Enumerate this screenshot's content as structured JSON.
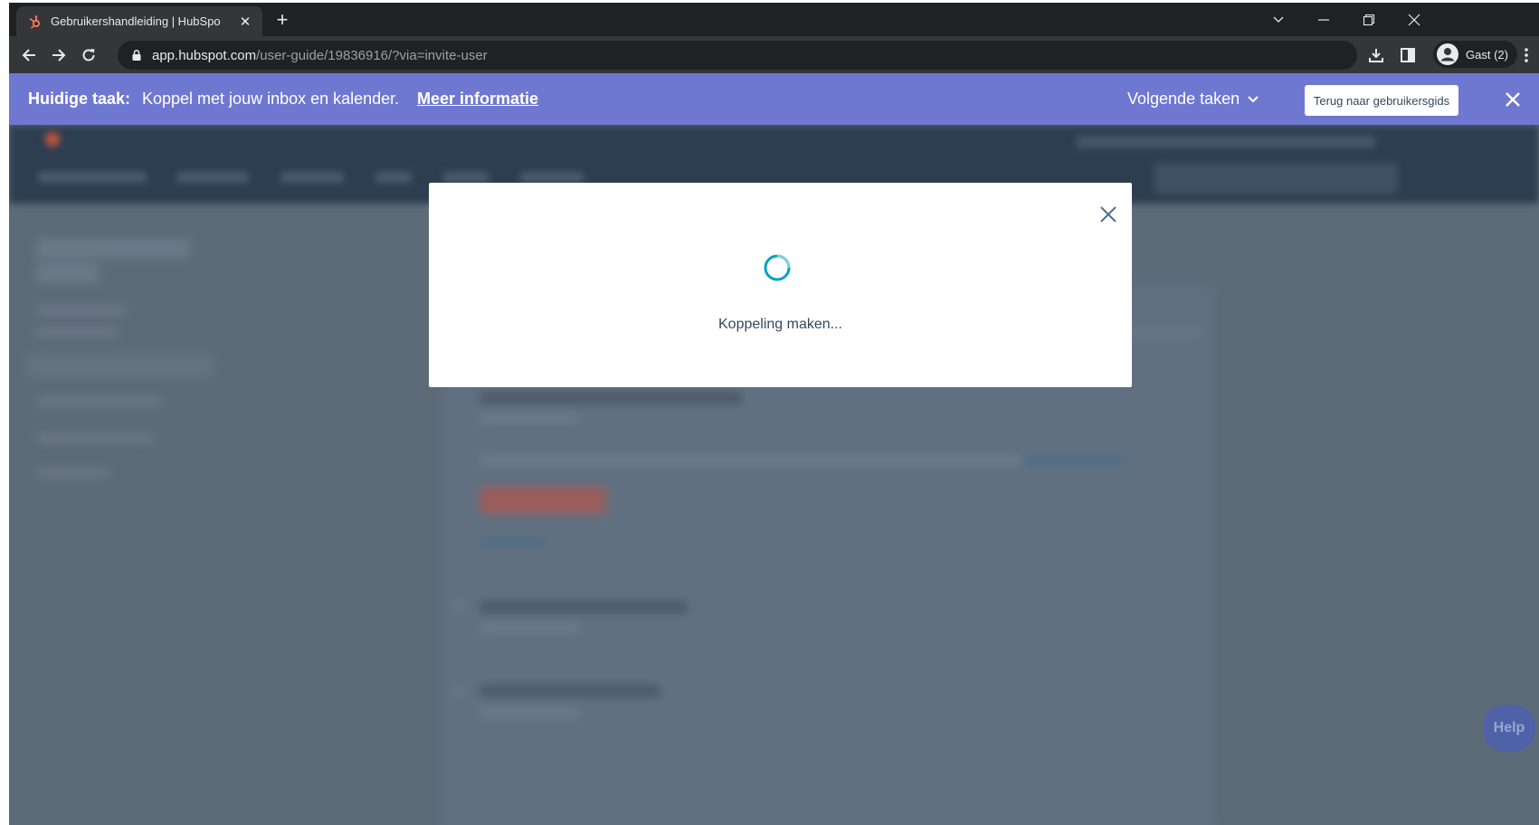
{
  "browser": {
    "tab_title": "Gebruikershandleiding | HubSpo",
    "url_host": "app.hubspot.com",
    "url_path": "/user-guide/19836916/?via=invite-user",
    "profile_label": "Gast (2)"
  },
  "task_banner": {
    "label": "Huidige taak:",
    "text": "Koppel met jouw inbox en kalender.",
    "more_link": "Meer informatie",
    "next_tasks": "Volgende taken",
    "back_button": "Terug naar gebruikersgids"
  },
  "modal": {
    "status_text": "Koppeling maken..."
  },
  "help_button": "Help",
  "colors": {
    "banner": "#6f78d0",
    "spinner": "#00a4bd",
    "overlay": "#5d6b79",
    "app_nav": "#2d3e50"
  }
}
